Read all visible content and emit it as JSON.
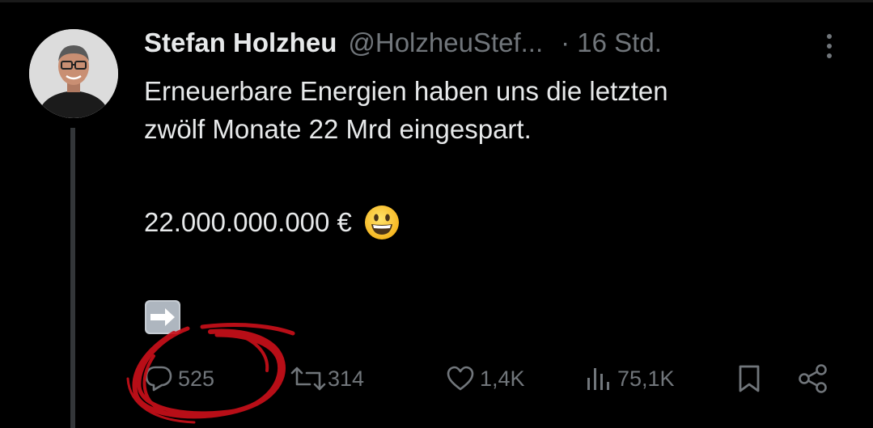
{
  "tweet": {
    "author_name": "Stefan Holzheu",
    "handle": "@HolzheuStef...",
    "time": "· 16 Std.",
    "text_line1": "Erneuerbare Energien haben uns die letzten",
    "text_line2": "zwölf Monate 22 Mrd eingespart.",
    "amount": "22.000.000.000 €",
    "emoji_face": "grinning-face-icon",
    "emoji_arrow": "right-arrow-icon"
  },
  "actions": {
    "replies": "525",
    "retweets": "314",
    "likes": "1,4K",
    "views": "75,1K"
  },
  "colors": {
    "background": "#000000",
    "text": "#e7e9ea",
    "muted": "#71767b",
    "annotation_red": "#c8101a"
  }
}
